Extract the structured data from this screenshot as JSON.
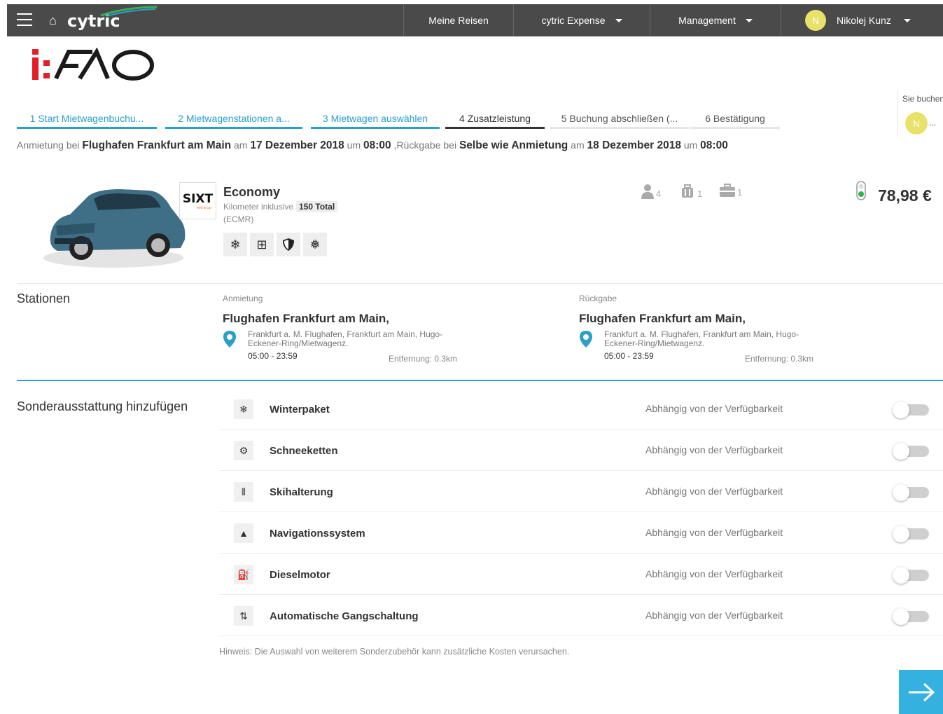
{
  "topbar": {
    "brand": "cytric",
    "nav": {
      "trips": "Meine Reisen",
      "expense": "cytric Expense",
      "management": "Management",
      "user_initial": "N",
      "user_name": "Nikolej Kunz"
    }
  },
  "logo_text": "i:FAO",
  "booking_for": {
    "label": "Sie buchen",
    "initial": "N",
    "more": "..."
  },
  "steps": [
    {
      "label": "1  Start Mietwagenbuchu..."
    },
    {
      "label": "2  Mietwagenstationen a..."
    },
    {
      "label": "3  Mietwagen auswählen"
    },
    {
      "label": "4  Zusatzleistung"
    },
    {
      "label": "5  Buchung abschließen (..."
    },
    {
      "label": "6  Bestätigung"
    }
  ],
  "summary": {
    "t1": "Anmietung bei ",
    "pickup_place": "Flughafen Frankfurt am Main",
    "t2": " am ",
    "pickup_date": "17 Dezember 2018",
    "t3": " um ",
    "pickup_time": "08:00",
    "t4": " ,Rückgabe bei ",
    "return_place": "Selbe wie Anmietung",
    "t5": " am ",
    "return_date": "18 Dezember 2018",
    "t6": " um ",
    "return_time": "08:00"
  },
  "car": {
    "vendor": "SIXT",
    "vendor_tag": "rent a car",
    "category": "Economy",
    "km_label": "Kilometer inklusive",
    "km_value": "150 Total",
    "acriss": "(ECMR)",
    "features": [
      "winter-icon",
      "manual-gear-icon",
      "insurance-shield-icon",
      "air-conditioning-icon"
    ],
    "passengers": "4",
    "suitcases": "1",
    "briefcases": "1",
    "price": "78,98 €",
    "status_color": "#2fb34a"
  },
  "stations": {
    "title": "Stationen",
    "pickup": {
      "label": "Anmietung",
      "name": "Flughafen Frankfurt am Main,",
      "address": "Frankfurt a. M. Flughafen, Frankfurt am Main, Hugo-Eckener-Ring/Mietwagenz.",
      "hours": "05:00 - 23:59",
      "distance": "Entfernung: 0.3km"
    },
    "return": {
      "label": "Rückgabe",
      "name": "Flughafen Frankfurt am Main,",
      "address": "Frankfurt a. M. Flughafen, Frankfurt am Main, Hugo-Eckener-Ring/Mietwagenz.",
      "hours": "05:00 - 23:59",
      "distance": "Entfernung: 0.3km"
    }
  },
  "extras": {
    "title": "Sonderausstattung hinzufügen",
    "items": [
      {
        "name": "Winterpaket",
        "availability": "Abhängig von der Verfügbarkeit",
        "icon": "winter-tire-icon",
        "glyph": "❄",
        "enabled": false
      },
      {
        "name": "Schneeketten",
        "availability": "Abhängig von der Verfügbarkeit",
        "icon": "snow-chain-icon",
        "glyph": "⚙",
        "enabled": false
      },
      {
        "name": "Skihalterung",
        "availability": "Abhängig von der Verfügbarkeit",
        "icon": "ski-rack-icon",
        "glyph": "⫼",
        "enabled": false
      },
      {
        "name": "Navigationssystem",
        "availability": "Abhängig von der Verfügbarkeit",
        "icon": "navigation-icon",
        "glyph": "▲",
        "enabled": false
      },
      {
        "name": "Dieselmotor",
        "availability": "Abhängig von der Verfügbarkeit",
        "icon": "fuel-pump-icon",
        "glyph": "⛽",
        "enabled": false
      },
      {
        "name": "Automatische Gangschaltung",
        "availability": "Abhängig von der Verfügbarkeit",
        "icon": "automatic-gear-icon",
        "glyph": "⇅",
        "enabled": false
      }
    ],
    "hint": "Hinweis: Die Auswahl von weiterem Sonderzubehör kann zusätzliche Kosten verursachen."
  },
  "colors": {
    "accent": "#2a9fc9",
    "topbar": "#4a4a4a",
    "next_button": "#35b1e0"
  }
}
